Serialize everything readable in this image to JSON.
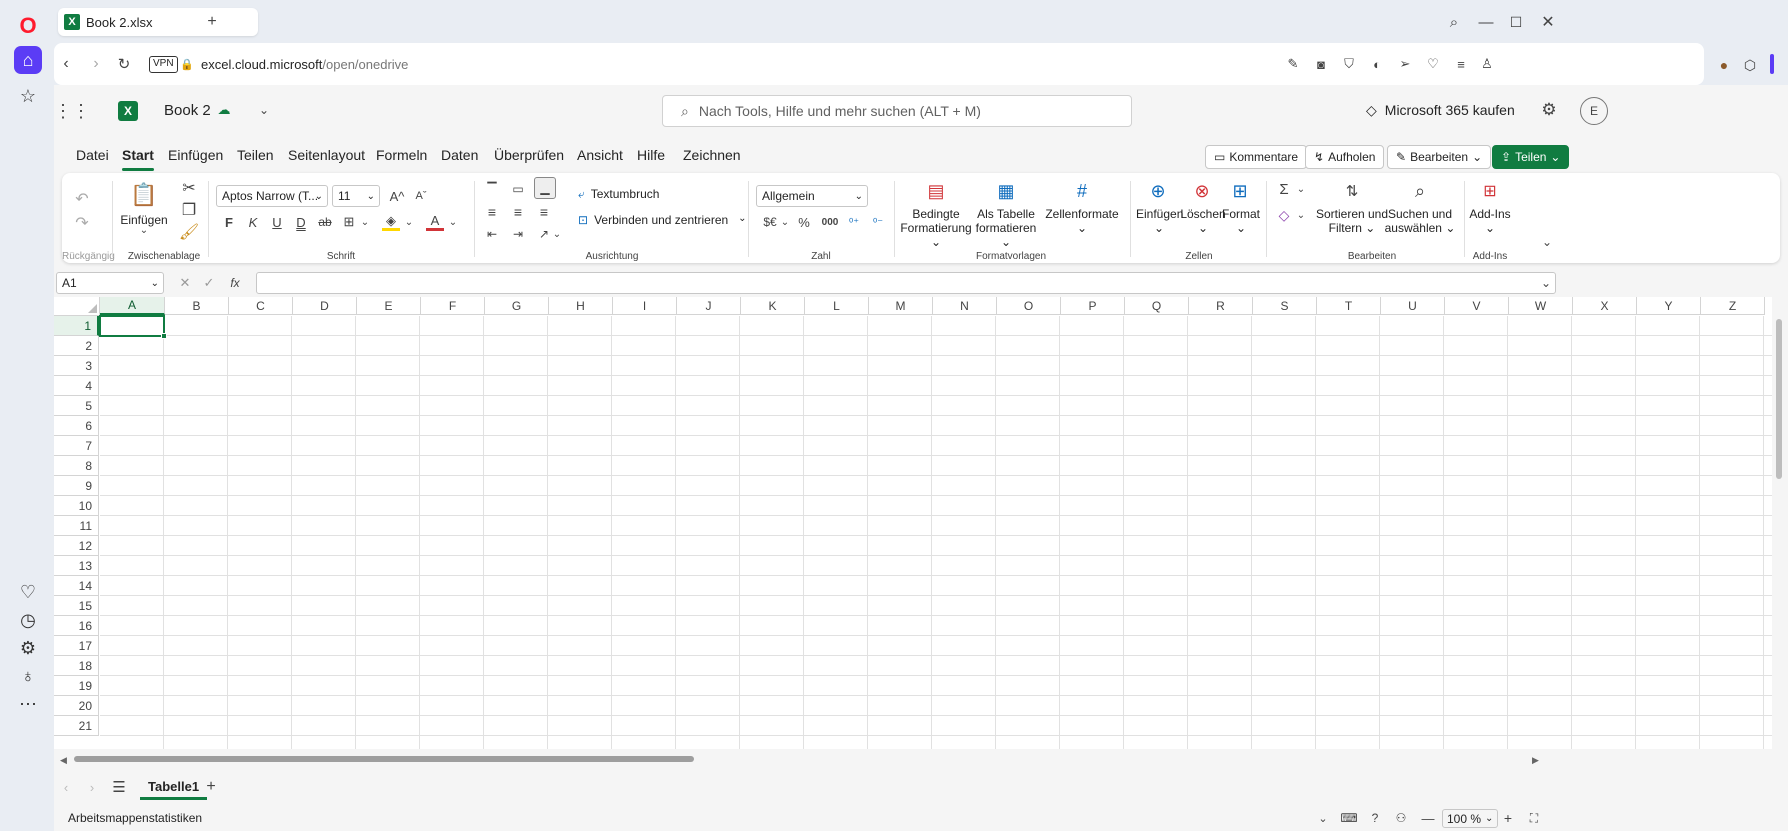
{
  "browser": {
    "tab_title": "Book 2.xlsx",
    "vpn": "VPN",
    "url_host": "excel.cloud.microsoft",
    "url_path": "/open/onedrive"
  },
  "header": {
    "app_letter": "X",
    "doc_title": "Book 2",
    "search_placeholder": "Nach Tools, Hilfe und mehr suchen (ALT + M)",
    "buy_label": "Microsoft 365 kaufen",
    "avatar_letter": "E"
  },
  "menu": {
    "items": [
      "Datei",
      "Start",
      "Einfügen",
      "Teilen",
      "Seitenlayout",
      "Formeln",
      "Daten",
      "Überprüfen",
      "Ansicht",
      "Hilfe",
      "Zeichnen"
    ],
    "active": "Start",
    "comments_label": "Kommentare",
    "catchup_label": "Aufholen",
    "edit_label": "Bearbeiten",
    "share_label": "Teilen"
  },
  "ribbon": {
    "groups": {
      "undo": "Rückgängig",
      "clipboard": "Zwischenablage",
      "font": "Schrift",
      "alignment": "Ausrichtung",
      "number": "Zahl",
      "styles": "Formatvorlagen",
      "cells": "Zellen",
      "editing": "Bearbeiten",
      "addins": "Add-Ins"
    },
    "paste_label": "Einfügen",
    "font_name": "Aptos Narrow (T...",
    "font_size": "11",
    "bold": "F",
    "italic": "K",
    "underline": "U",
    "double_underline": "D",
    "strike": "ab",
    "wrap_text": "Textumbruch",
    "merge_center": "Verbinden und zentrieren",
    "number_format": "Allgemein",
    "currency": "$€",
    "percent": "%",
    "thousands": "000",
    "cond_format_1": "Bedingte",
    "cond_format_2": "Formatierung",
    "as_table_1": "Als Tabelle",
    "as_table_2": "formatieren",
    "cell_styles": "Zellenformate",
    "insert_cells": "Einfügen",
    "delete_cells": "Löschen",
    "format_cells": "Format",
    "sort_filter_1": "Sortieren und",
    "sort_filter_2": "Filtern",
    "find_select_1": "Suchen und",
    "find_select_2": "auswählen",
    "addins_btn": "Add-Ins"
  },
  "formula_bar": {
    "name_box": "A1",
    "fx": "fx",
    "value": ""
  },
  "grid": {
    "columns": [
      "A",
      "B",
      "C",
      "D",
      "E",
      "F",
      "G",
      "H",
      "I",
      "J",
      "K",
      "L",
      "M",
      "N",
      "O",
      "P",
      "Q",
      "R",
      "S",
      "T",
      "U",
      "V",
      "W",
      "X",
      "Y",
      "Z"
    ],
    "rows": [
      "1",
      "2",
      "3",
      "4",
      "5",
      "6",
      "7",
      "8",
      "9",
      "10",
      "11",
      "12",
      "13",
      "14",
      "15",
      "16",
      "17",
      "18",
      "19",
      "20",
      "21"
    ],
    "selected_cell": "A1"
  },
  "sheets": {
    "tabs": [
      "Tabelle1"
    ],
    "active": "Tabelle1"
  },
  "status": {
    "left": "Arbeitsmappenstatistiken",
    "zoom": "100 %"
  },
  "colors": {
    "accent": "#107c41",
    "opera_red": "#ff1b2d",
    "sidebar_active": "#5b3cf5"
  }
}
